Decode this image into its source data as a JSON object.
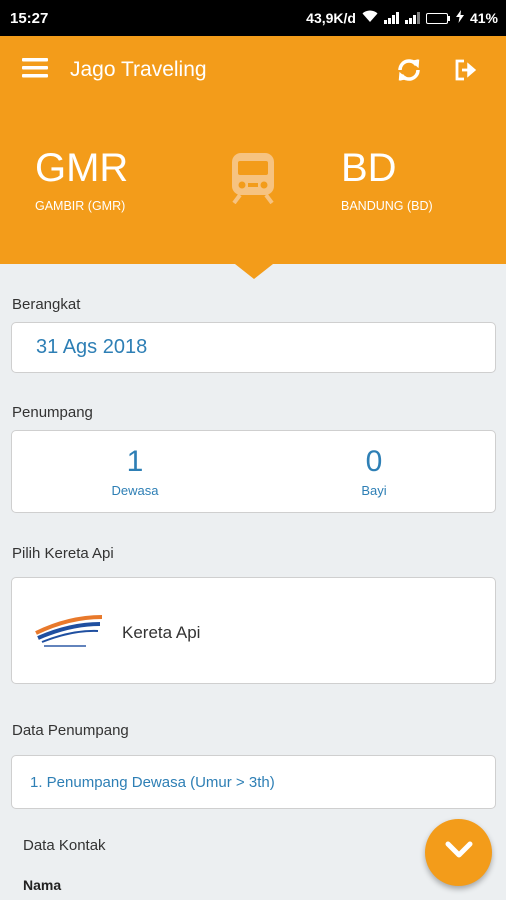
{
  "status": {
    "time": "15:27",
    "speed": "43,9K/d",
    "battery": "41%",
    "battery_level": 0.41
  },
  "appbar": {
    "title": "Jago Traveling",
    "icons": [
      "menu-icon",
      "refresh-icon",
      "logout-icon"
    ]
  },
  "route": {
    "origin": {
      "code": "GMR",
      "name": "GAMBIR (GMR)"
    },
    "destination": {
      "code": "BD",
      "name": "BANDUNG (BD)"
    },
    "icon": "train-icon"
  },
  "departure": {
    "label": "Berangkat",
    "date": "31 Ags 2018"
  },
  "passengers": {
    "label": "Penumpang",
    "adult": {
      "count": "1",
      "label": "Dewasa"
    },
    "infant": {
      "count": "0",
      "label": "Bayi"
    }
  },
  "train": {
    "label": "Pilih Kereta Api",
    "name": "Kereta Api"
  },
  "passenger_data": {
    "label": "Data Penumpang",
    "item": "1. Penumpang Dewasa (Umur > 3th)"
  },
  "contact": {
    "label": "Data Kontak",
    "name_label": "Nama"
  },
  "colors": {
    "primary": "#f39c1a",
    "link": "#2e7fb5",
    "background": "#eceff1"
  }
}
